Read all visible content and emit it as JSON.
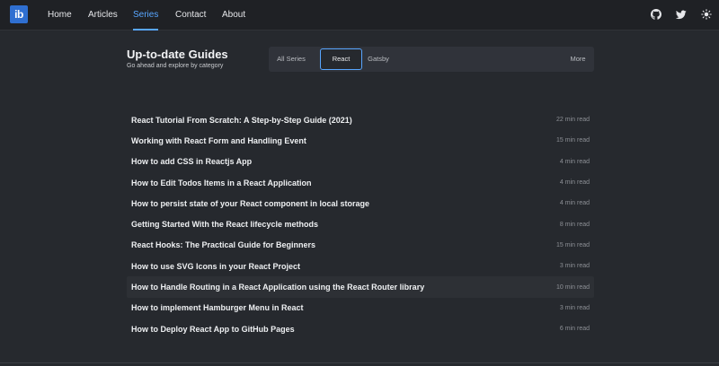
{
  "header": {
    "logo_text": "ib",
    "nav": [
      {
        "label": "Home",
        "active": false
      },
      {
        "label": "Articles",
        "active": false
      },
      {
        "label": "Series",
        "active": true
      },
      {
        "label": "Contact",
        "active": false
      },
      {
        "label": "About",
        "active": false
      }
    ],
    "icons": [
      "github-icon",
      "twitter-icon",
      "sun-icon"
    ]
  },
  "main": {
    "title": "Up-to-date Guides",
    "subtitle": "Go ahead and explore by category",
    "tabs": [
      {
        "label": "All Series",
        "selected": false
      },
      {
        "label": "React",
        "selected": true
      },
      {
        "label": "Gatsby",
        "selected": false
      }
    ],
    "more_label": "More",
    "articles": [
      {
        "title": "React Tutorial From Scratch: A Step-by-Step Guide (2021)",
        "read_time": "22 min read"
      },
      {
        "title": "Working with React Form and Handling Event",
        "read_time": "15 min read"
      },
      {
        "title": "How to add CSS in Reactjs App",
        "read_time": "4 min read"
      },
      {
        "title": "How to Edit Todos Items in a React Application",
        "read_time": "4 min read"
      },
      {
        "title": "How to persist state of your React component in local storage",
        "read_time": "4 min read"
      },
      {
        "title": "Getting Started With the React lifecycle methods",
        "read_time": "8 min read"
      },
      {
        "title": "React Hooks: The Practical Guide for Beginners",
        "read_time": "15 min read"
      },
      {
        "title": "How to use SVG Icons in your React Project",
        "read_time": "3 min read"
      },
      {
        "title": "How to Handle Routing in a React Application using the React Router library",
        "read_time": "10 min read"
      },
      {
        "title": "How to implement Hamburger Menu in React",
        "read_time": "3 min read"
      },
      {
        "title": "How to Deploy React App to GitHub Pages",
        "read_time": "6 min read"
      }
    ]
  },
  "colors": {
    "background": "#26292e",
    "header": "#1f2125",
    "accent": "#58a6ff",
    "logo": "#2f6fd1"
  }
}
